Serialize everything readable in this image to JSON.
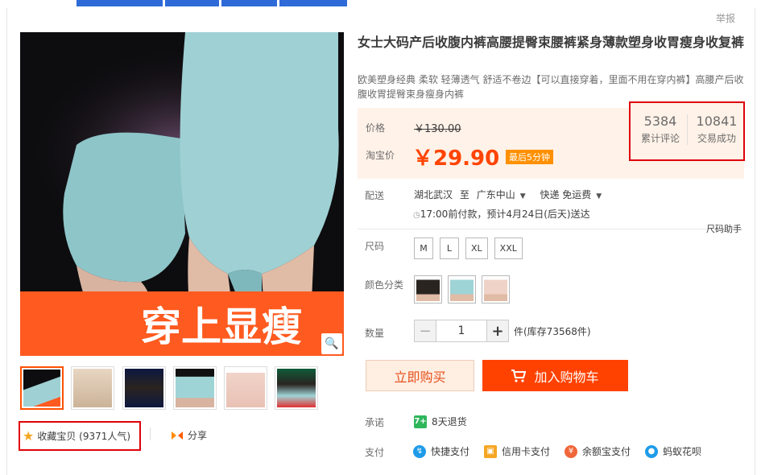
{
  "report": "举报",
  "product": {
    "title": "女士大码产后收腹内裤高腰提臀束腰裤紧身薄款塑身收胃瘦身收复裤",
    "subtitle": "欧美塑身经典 柔软 轻薄透气 舒适不卷边【可以直接穿着，里面不用在穿内裤】高腰产后收腹收胃提臀束身瘦身内裤",
    "banner_text": "穿上显瘦"
  },
  "price": {
    "orig_label": "价格",
    "orig_value": "￥130.00",
    "tb_label": "淘宝价",
    "tb_value": "￥29.90",
    "promo_tag": "最后5分钟"
  },
  "counters": {
    "reviews_value": "5384",
    "reviews_label": "累计评论",
    "sales_value": "10841",
    "sales_label": "交易成功"
  },
  "shipping": {
    "label": "配送",
    "from": "湖北武汉",
    "to_word": "至",
    "to": "广东中山",
    "method": "快递 免运费",
    "eta": "17:00前付款，预计4月24日(后天)送达"
  },
  "size_help": "尺码助手",
  "size": {
    "label": "尺码",
    "options": [
      "M",
      "L",
      "XL",
      "XXL"
    ]
  },
  "color": {
    "label": "颜色分类",
    "swatches": [
      "#2a2420",
      "#9fd4d6",
      "#f0d3c8"
    ]
  },
  "quantity": {
    "label": "数量",
    "value": "1",
    "stock": "件(库存73568件)"
  },
  "actions": {
    "buy_now": "立即购买",
    "add_cart": "加入购物车"
  },
  "promise": {
    "label": "承诺",
    "text": "8天退货"
  },
  "payment": {
    "label": "支付",
    "methods": [
      "快捷支付",
      "信用卡支付",
      "余额宝支付",
      "蚂蚁花呗"
    ]
  },
  "favorite": {
    "text": "收藏宝贝 (9371人气)"
  },
  "share": {
    "text": "分享"
  },
  "icon_names": [
    "star-icon",
    "share-icon",
    "zoom-icon",
    "cart-icon",
    "chevron-down-icon"
  ],
  "colors": {
    "accent": "#ff4400",
    "highlight_border": "#e0000b",
    "price_bg": "#fff2e8"
  }
}
